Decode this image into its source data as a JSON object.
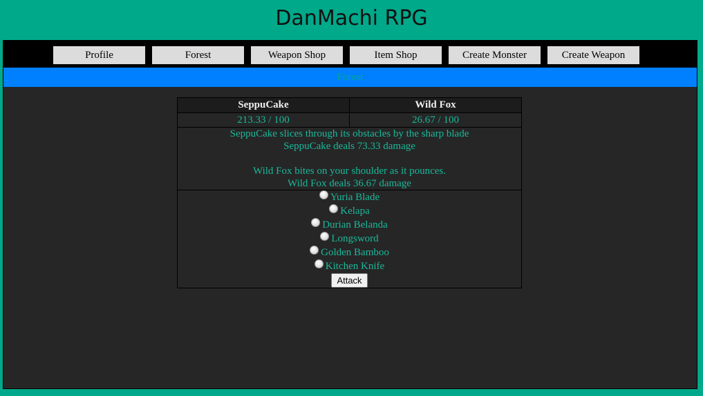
{
  "site": {
    "title": "DanMachi RPG"
  },
  "nav": {
    "items": [
      {
        "label": "Profile"
      },
      {
        "label": "Forest"
      },
      {
        "label": "Weapon Shop"
      },
      {
        "label": "Item Shop"
      },
      {
        "label": "Create Monster"
      },
      {
        "label": "Create Weapon"
      }
    ]
  },
  "location": {
    "label": "Forest"
  },
  "battle": {
    "player": {
      "name": "SeppuCake",
      "hp": "213.33 / 100"
    },
    "enemy": {
      "name": "Wild Fox",
      "hp": "26.67 / 100"
    },
    "log": {
      "player_action": "SeppuCake slices through its obstacles by the sharp blade",
      "player_damage": "SeppuCake deals 73.33 damage",
      "enemy_action": "Wild Fox bites on your shoulder as it pounces.",
      "enemy_damage": "Wild Fox deals 36.67 damage"
    },
    "weapons": [
      {
        "label": "Yuria Blade"
      },
      {
        "label": "Kelapa"
      },
      {
        "label": "Durian Belanda"
      },
      {
        "label": "Longsword"
      },
      {
        "label": "Golden Bamboo"
      },
      {
        "label": "Kitchen Knife"
      }
    ],
    "attack_label": "Attack"
  },
  "colors": {
    "page_background": "#00a98a",
    "panel_background": "#262626",
    "navbar_background": "#000000",
    "location_bar": "#0080ff",
    "text_accent": "#1ab89a"
  }
}
